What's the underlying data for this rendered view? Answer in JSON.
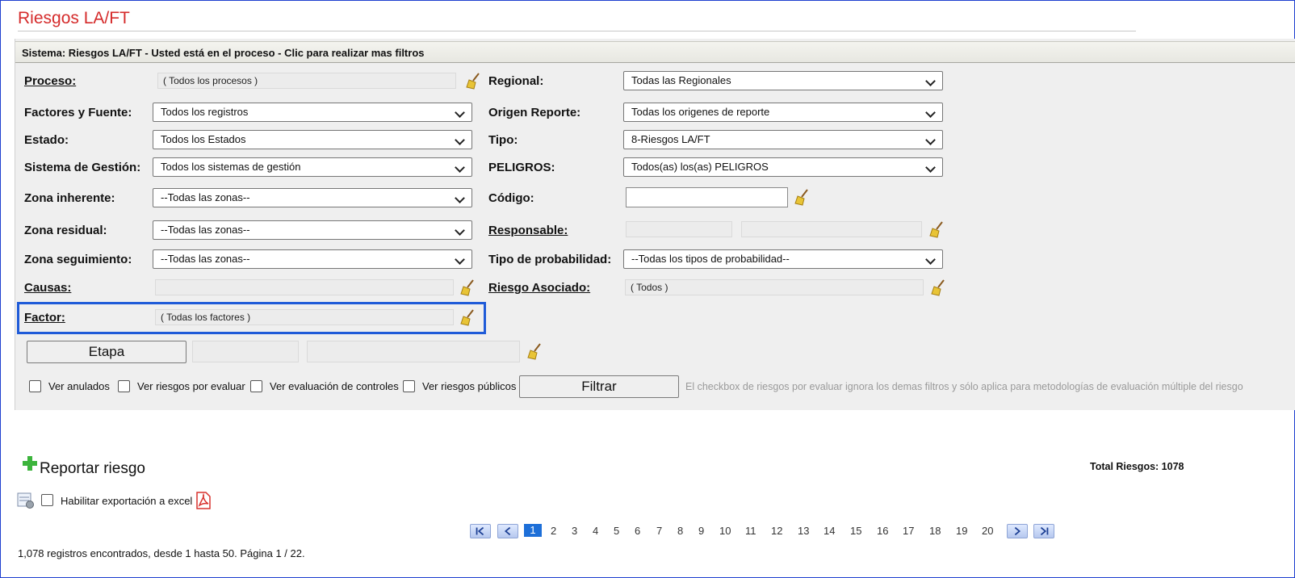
{
  "page": {
    "title": "Riesgos LA/FT"
  },
  "panel": {
    "header": "Sistema: Riesgos LA/FT - Usted está en el proceso - Clic para realizar mas filtros"
  },
  "filters": {
    "proceso": {
      "label": "Proceso:",
      "value": "( Todos los procesos )"
    },
    "regional": {
      "label": "Regional:",
      "value": "Todas las Regionales"
    },
    "factores": {
      "label": "Factores y Fuente:",
      "value": "Todos los registros"
    },
    "origen": {
      "label": "Origen Reporte:",
      "value": "Todas los origenes de reporte"
    },
    "estado": {
      "label": "Estado:",
      "value": "Todos los Estados"
    },
    "tipo": {
      "label": "Tipo:",
      "value": "8-Riesgos LA/FT"
    },
    "sistema": {
      "label": "Sistema de Gestión:",
      "value": "Todos los sistemas de gestión"
    },
    "peligros": {
      "label": "PELIGROS:",
      "value": "Todos(as) los(as) PELIGROS"
    },
    "zona_inherente": {
      "label": "Zona inherente:",
      "value": "--Todas las zonas--"
    },
    "codigo": {
      "label": "Código:",
      "value": ""
    },
    "zona_residual": {
      "label": "Zona residual:",
      "value": "--Todas las zonas--"
    },
    "responsable": {
      "label": "Responsable:"
    },
    "zona_seguimiento": {
      "label": "Zona seguimiento:",
      "value": "--Todas las zonas--"
    },
    "tipo_probabilidad": {
      "label": "Tipo de probabilidad:",
      "value": "--Todas los tipos de probabilidad--"
    },
    "causas": {
      "label": "Causas:",
      "value": ""
    },
    "riesgo_asociado": {
      "label": "Riesgo Asociado:",
      "value": "( Todos )"
    },
    "factor": {
      "label": "Factor:",
      "value": "( Todas los factores )"
    },
    "etapa": {
      "label": "Etapa"
    }
  },
  "checkboxes": {
    "anulados": "Ver anulados",
    "por_evaluar": "Ver riesgos por evaluar",
    "evaluacion": "Ver evaluación de controles",
    "publicos": "Ver riesgos públicos"
  },
  "filter_button": "Filtrar",
  "filter_note": "El checkbox de riesgos por evaluar ignora los demas filtros y sólo aplica para metodologías de evaluación múltiple del riesgo",
  "report": {
    "label": "Reportar riesgo",
    "total": "Total Riesgos: 1078"
  },
  "export": {
    "label": "Habilitar exportación a excel"
  },
  "pagination": {
    "current": "1",
    "pages": [
      "2",
      "3",
      "4",
      "5",
      "6",
      "7",
      "8",
      "9",
      "10",
      "11",
      "12",
      "13",
      "14",
      "15",
      "16",
      "17",
      "18",
      "19",
      "20"
    ]
  },
  "records_text": "1,078 registros encontrados, desde 1 hasta 50. Página 1 / 22.",
  "colors": {
    "title": "#d52b2b",
    "highlight": "#1f5bd8",
    "add": "#3cb43c",
    "page_active": "#1d6fd8"
  },
  "icons": [
    "broom-icon",
    "plus-icon",
    "export-settings-icon",
    "pdf-icon",
    "first-page-icon",
    "prev-page-icon",
    "next-page-icon",
    "last-page-icon",
    "chevron-down-icon"
  ]
}
